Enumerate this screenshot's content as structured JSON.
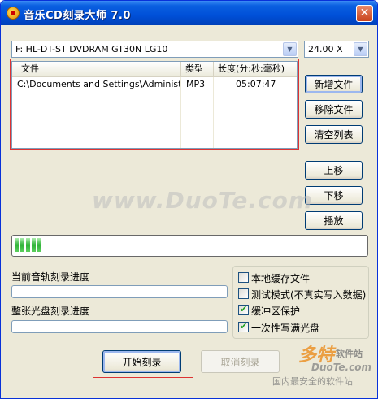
{
  "window": {
    "title": "音乐CD刻录大师  7.0",
    "close_glyph": "✕"
  },
  "drive_select": {
    "value": "F: HL-DT-ST DVDRAM GT30N LG10",
    "arrow_glyph": "▼"
  },
  "speed_select": {
    "value": "24.00 X",
    "arrow_glyph": "▼"
  },
  "file_list": {
    "columns": [
      "文件",
      "类型",
      "长度(分:秒:毫秒)"
    ],
    "rows": [
      {
        "file": "C:\\Documents and Settings\\Administra...",
        "type": "MP3",
        "length": "05:07:47"
      }
    ]
  },
  "side_buttons": {
    "add_file": "新增文件",
    "remove_file": "移除文件",
    "clear_list": "清空列表",
    "move_up": "上移",
    "move_down": "下移",
    "play": "播放"
  },
  "progress": {
    "buffer_blocks": 5
  },
  "labels": {
    "track_progress": "当前音轨刻录进度",
    "disc_progress": "整张光盘刻录进度"
  },
  "options": [
    {
      "label": "本地缓存文件",
      "checked": false
    },
    {
      "label": "测试模式(不真实写入数据)",
      "checked": false
    },
    {
      "label": "缓冲区保护",
      "checked": true
    },
    {
      "label": "一次性写满光盘",
      "checked": true
    }
  ],
  "check_glyph": "✔",
  "actions": {
    "start_burn": "开始刻录",
    "cancel_burn": "取消刻录"
  },
  "watermarks": {
    "duote": "www.DuoTe.com",
    "logo": "多特",
    "logo_suffix": "软件站",
    "url": "DuoTe.com",
    "slogan": "国内最安全的软件站"
  }
}
